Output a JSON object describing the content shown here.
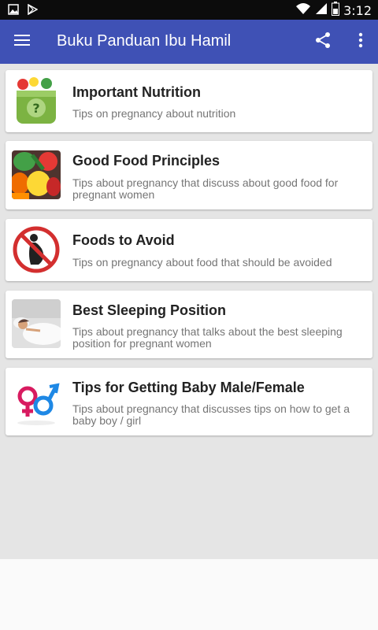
{
  "status_bar": {
    "time": "3:12",
    "icons": [
      "image-icon",
      "play-store-icon",
      "wifi-icon",
      "signal-icon",
      "battery-icon"
    ]
  },
  "app_bar": {
    "title": "Buku Panduan Ibu Hamil",
    "background": "#3f51b5",
    "icons": [
      "menu-icon",
      "share-icon",
      "more-vert-icon"
    ]
  },
  "items": [
    {
      "title": "Important Nutrition",
      "description": "Tips on pregnancy about nutrition",
      "icon": "nutrition-icon"
    },
    {
      "title": "Good Food Principles",
      "description": "Tips about pregnancy that discuss about good food for pregnant women",
      "icon": "vegetables-icon"
    },
    {
      "title": "Foods to Avoid",
      "description": "Tips on pregnancy about food that should be avoided",
      "icon": "no-pregnant-icon"
    },
    {
      "title": "Best Sleeping Position",
      "description": "Tips about pregnancy that talks about the best sleeping position for pregnant women",
      "icon": "sleeping-woman-icon"
    },
    {
      "title": "Tips for Getting Baby Male/Female",
      "description": "Tips about pregnancy that discusses tips on how to get a baby boy / girl",
      "icon": "gender-symbols-icon"
    }
  ]
}
